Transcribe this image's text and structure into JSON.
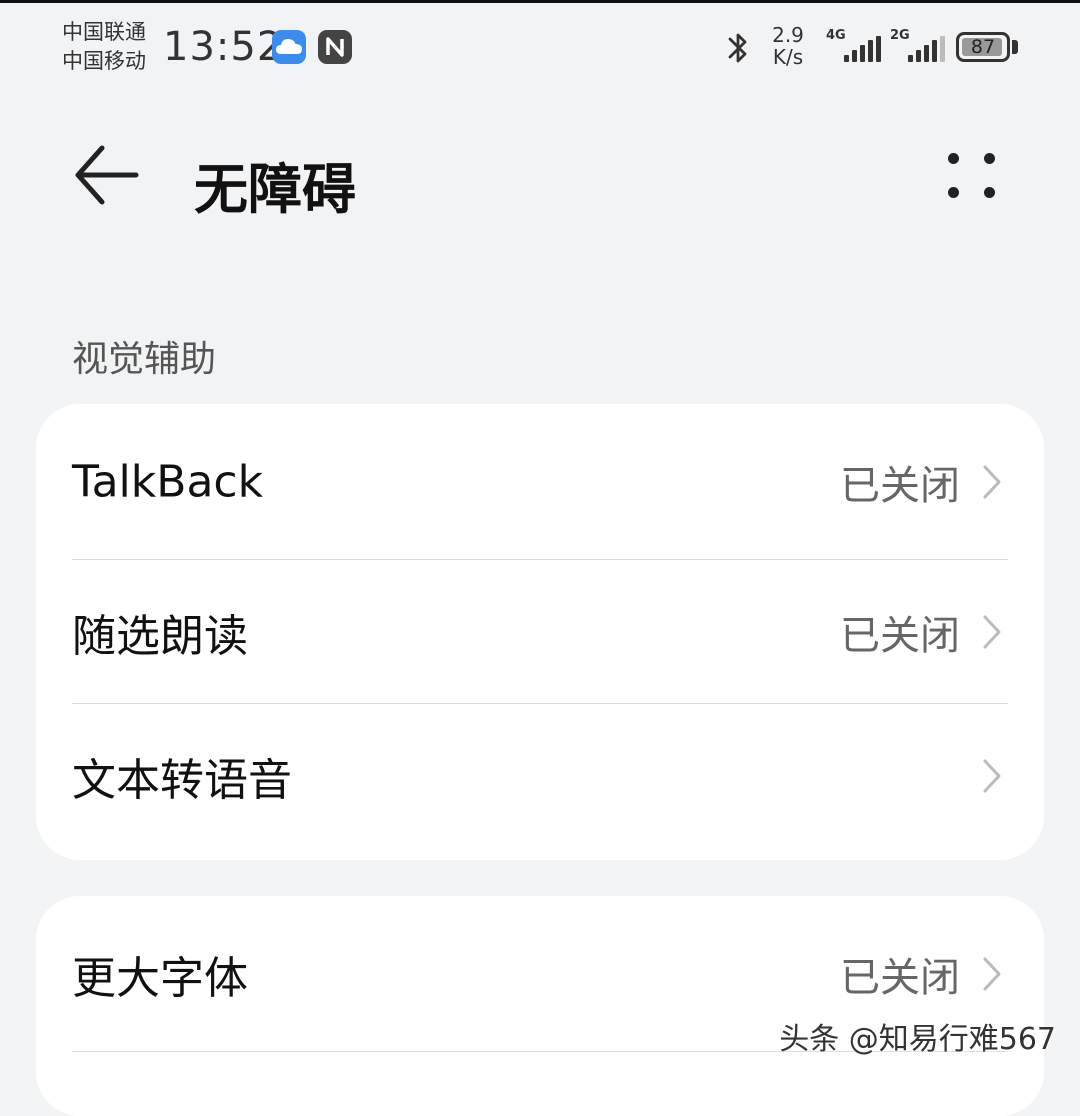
{
  "status_bar": {
    "carrier_1": "中国联通",
    "carrier_2": "中国移动",
    "time": "13:52",
    "net_speed_value": "2.9",
    "net_speed_unit": "K/s",
    "sim1_tag": "4G",
    "sim2_tag": "2G",
    "battery_level": "87",
    "icons": [
      "cloud-icon",
      "nfc-icon",
      "bluetooth-icon",
      "signal-4g-icon",
      "signal-2g-icon",
      "battery-icon"
    ]
  },
  "header": {
    "title": "无障碍",
    "back_icon": "arrow-left-icon",
    "more_icon": "more-dots-icon"
  },
  "sections": [
    {
      "label": "视觉辅助",
      "items": [
        {
          "label": "TalkBack",
          "status": "已关闭"
        },
        {
          "label": "随选朗读",
          "status": "已关闭"
        },
        {
          "label": "文本转语音",
          "status": ""
        }
      ]
    }
  ],
  "card2": {
    "items": [
      {
        "label": "更大字体",
        "status": "已关闭"
      }
    ]
  },
  "watermark": "头条 @知易行难567",
  "colors": {
    "background": "#f1f3f5",
    "card": "#ffffff",
    "cloud_badge": "#3a8cf0",
    "status_text": "#666666"
  }
}
